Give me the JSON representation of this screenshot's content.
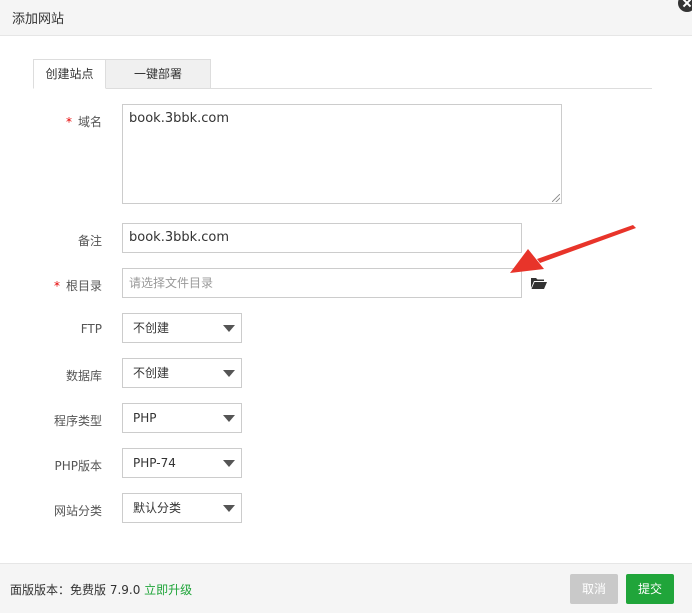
{
  "dialog": {
    "title": "添加网站"
  },
  "tabs": [
    {
      "label": "创建站点",
      "active": true
    },
    {
      "label": "一键部署",
      "active": false
    }
  ],
  "form": {
    "domain": {
      "label": "域名",
      "required": true,
      "value": "book.3bbk.com"
    },
    "note": {
      "label": "备注",
      "value": "book.3bbk.com"
    },
    "root": {
      "label": "根目录",
      "required": true,
      "placeholder": "请选择文件目录",
      "value": ""
    },
    "ftp": {
      "label": "FTP",
      "value": "不创建"
    },
    "database": {
      "label": "数据库",
      "value": "不创建"
    },
    "program_type": {
      "label": "程序类型",
      "value": "PHP"
    },
    "php_version": {
      "label": "PHP版本",
      "value": "PHP-74"
    },
    "category": {
      "label": "网站分类",
      "value": "默认分类"
    }
  },
  "footer": {
    "version_prefix": "面版版本：免费版 7.9.0 ",
    "upgrade_link": "立即升级",
    "cancel_label": "取消",
    "submit_label": "提交"
  },
  "colors": {
    "accent": "#20a53a",
    "required": "#e60000",
    "annotation_arrow": "#e8342a"
  }
}
